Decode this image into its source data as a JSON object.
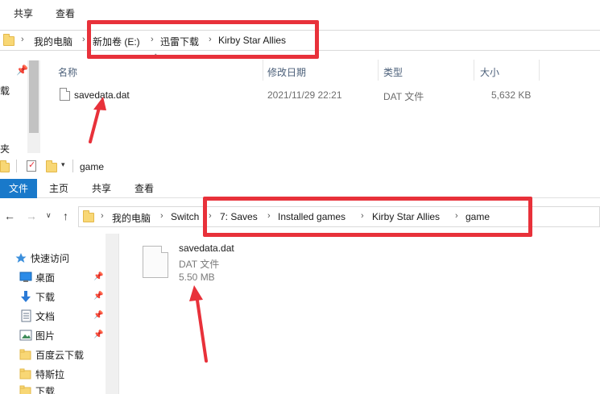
{
  "top_window": {
    "ribbon_tabs": [
      "共享",
      "查看"
    ],
    "breadcrumb": [
      "我的电脑",
      "新加卷 (E:)",
      "迅雷下载",
      "Kirby Star Allies"
    ],
    "columns": [
      "名称",
      "修改日期",
      "类型",
      "大小"
    ],
    "files": [
      {
        "name": "savedata.dat",
        "modified": "2021/11/29 22:21",
        "type": "DAT 文件",
        "size": "5,632 KB"
      }
    ],
    "left_fragments": [
      "载",
      "夹"
    ]
  },
  "bottom_window": {
    "title": "game",
    "ribbon_tabs": {
      "file": "文件",
      "home": "主页",
      "share": "共享",
      "view": "查看"
    },
    "breadcrumb": [
      "我的电脑",
      "Switch",
      "7: Saves",
      "Installed games",
      "Kirby Star Allies",
      "game"
    ],
    "nav_items": [
      {
        "label": "快速访问",
        "icon": "star-icon"
      },
      {
        "label": "桌面",
        "icon": "desktop-icon",
        "pinned": true
      },
      {
        "label": "下载",
        "icon": "download-icon",
        "pinned": true
      },
      {
        "label": "文档",
        "icon": "document-icon",
        "pinned": true
      },
      {
        "label": "图片",
        "icon": "picture-icon",
        "pinned": true
      },
      {
        "label": "百度云下载",
        "icon": "folder-icon"
      },
      {
        "label": "特斯拉",
        "icon": "folder-icon"
      },
      {
        "label": "下载",
        "icon": "folder-icon"
      }
    ],
    "tile_file": {
      "name": "savedata.dat",
      "type": "DAT 文件",
      "size": "5.50 MB"
    }
  },
  "colors": {
    "highlight": "#e8313a",
    "file_tab": "#1979ca"
  }
}
